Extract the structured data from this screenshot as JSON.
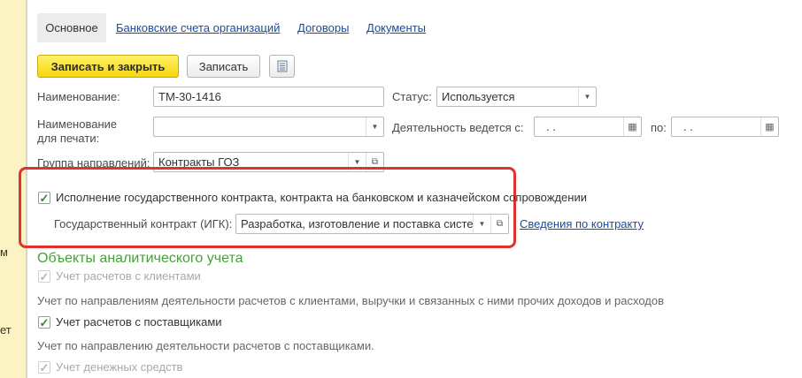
{
  "left_strip": {
    "fragments": [
      "м",
      "ет"
    ]
  },
  "tabs": [
    {
      "label": "Основное",
      "active": true
    },
    {
      "label": "Банковские счета организаций"
    },
    {
      "label": "Договоры"
    },
    {
      "label": "Документы"
    }
  ],
  "toolbar": {
    "save_close_label": "Записать и закрыть",
    "save_label": "Записать",
    "report_icon": "report-list-icon"
  },
  "form": {
    "name_label": "Наименование:",
    "name_value": "ТМ-30-1416",
    "status_label": "Статус:",
    "status_value": "Используется",
    "print_name_label_1": "Наименование",
    "print_name_label_2": "для печати:",
    "print_name_value": "",
    "activity_label": "Деятельность ведется с:",
    "activity_from_value": ".  .",
    "activity_to_label": "по:",
    "activity_to_value": ".  .",
    "group_label": "Группа направлений:",
    "group_value": "Контракты ГОЗ",
    "gov_contract_checkbox_label": "Исполнение государственного контракта, контракта на банковском и казначейском сопровождении",
    "gov_contract_checked": true,
    "igk_label": "Государственный контракт (ИГК):",
    "igk_value": "Разработка, изготовление и поставка систе",
    "contract_info_link": "Сведения по контракту"
  },
  "analytics": {
    "title": "Объекты аналитического учета",
    "items": [
      {
        "label": "Учет расчетов с клиентами",
        "checked": true,
        "disabled": true,
        "hint": "Учет по направлениям деятельности расчетов с клиентами, выручки и связанных с ними прочих доходов и расходов"
      },
      {
        "label": "Учет расчетов с поставщиками",
        "checked": true,
        "disabled": false,
        "hint": "Учет по направлению деятельности расчетов с поставщиками."
      },
      {
        "label": "Учет денежных средств",
        "checked": true,
        "disabled": true,
        "hint": ""
      }
    ]
  },
  "colors": {
    "primary_button": "#f6d60c",
    "link": "#1d4a9c",
    "section_title": "#45a039",
    "highlight_frame": "#e0322f",
    "checkbox_check": "#2c8a2c"
  }
}
